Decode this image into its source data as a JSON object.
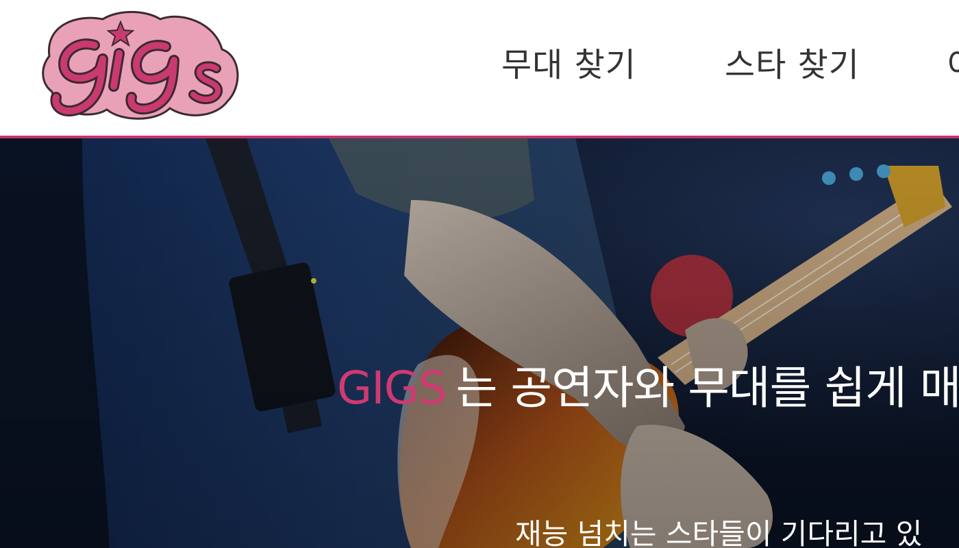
{
  "header": {
    "logo_text": "gigs",
    "nav": [
      {
        "label": "무대 찾기"
      },
      {
        "label": "스타 찾기"
      },
      {
        "label": "이"
      }
    ]
  },
  "hero": {
    "brand": "GIGS",
    "title_rest": "는 공연자와 무대를 쉽게 매",
    "subtitle": "재능 넘치는 스타들이 기다리고 있"
  },
  "colors": {
    "accent": "#c8336b",
    "logo_fill": "#c93a70",
    "logo_outline": "#e9a1b8",
    "nav_text": "#333333",
    "hero_text": "#ffffff"
  },
  "icons": {
    "logo": "gigs-logo-with-star"
  }
}
